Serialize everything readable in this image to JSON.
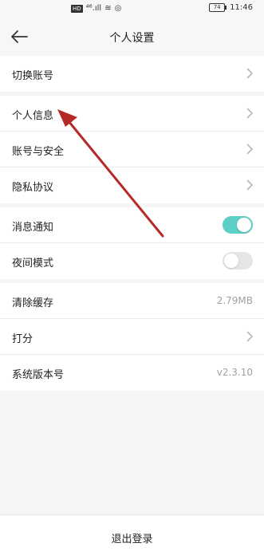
{
  "status_bar": {
    "time": "11:46",
    "battery": "74",
    "indicators": "HD ⁴⁶.ıll ≋ ◎"
  },
  "header": {
    "title": "个人设置",
    "back_icon": "back-arrow-icon"
  },
  "groups": [
    {
      "items": [
        {
          "label": "切换账号",
          "type": "chevron"
        }
      ]
    },
    {
      "items": [
        {
          "label": "个人信息",
          "type": "chevron"
        },
        {
          "label": "账号与安全",
          "type": "chevron"
        },
        {
          "label": "隐私协议",
          "type": "chevron"
        }
      ]
    },
    {
      "items": [
        {
          "label": "消息通知",
          "type": "toggle",
          "checked": true
        },
        {
          "label": "夜间模式",
          "type": "toggle",
          "checked": false
        }
      ]
    },
    {
      "items": [
        {
          "label": "清除缓存",
          "type": "value",
          "value": "2.79MB"
        },
        {
          "label": "打分",
          "type": "chevron"
        },
        {
          "label": "系统版本号",
          "type": "value",
          "value": "v2.3.10"
        }
      ]
    }
  ],
  "logout": {
    "label": "退出登录"
  },
  "colors": {
    "toggle_on": "#5cd0c4",
    "toggle_off": "#e5e5e5",
    "annotation_arrow": "#b52a28"
  }
}
